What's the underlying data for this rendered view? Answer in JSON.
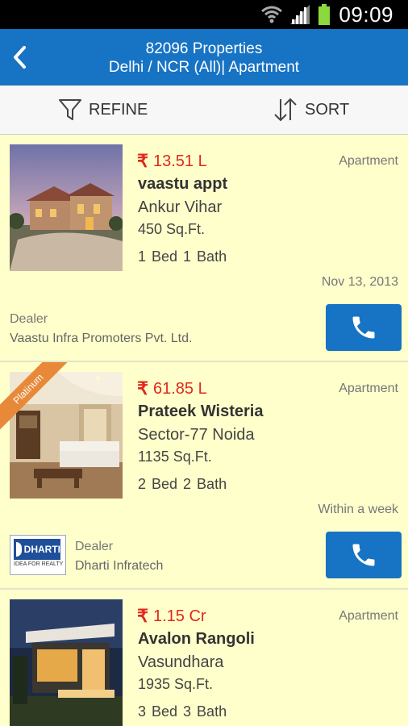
{
  "status_bar": {
    "time": "09:09"
  },
  "header": {
    "title_line1": "82096 Properties",
    "title_line2": "Delhi / NCR (All)| Apartment"
  },
  "toolbar": {
    "refine_label": "REFINE",
    "sort_label": "SORT"
  },
  "listings": [
    {
      "price": "13.51 L",
      "type": "Apartment",
      "name": "vaastu appt",
      "location": "Ankur Vihar",
      "area": "450 Sq.Ft.",
      "rooms": "1 Bed  1 Bath",
      "date": "Nov 13, 2013",
      "dealer_role": "Dealer",
      "dealer_name": "Vaastu Infra Promoters Pvt. Ltd."
    },
    {
      "badge": "Platinum",
      "price": "61.85 L",
      "type": "Apartment",
      "name": "Prateek Wisteria",
      "location": "Sector-77 Noida",
      "area": "1135 Sq.Ft.",
      "rooms": "2 Bed  2 Bath",
      "date": "Within a week",
      "dealer_role": "Dealer",
      "dealer_name": "Dharti Infratech",
      "dealer_logo_text": "DHARTI",
      "dealer_logo_tagline": "IDEA FOR REALTY"
    },
    {
      "price": "1.15 Cr",
      "type": "Apartment",
      "name": "Avalon Rangoli",
      "location": "Vasundhara",
      "area": "1935 Sq.Ft.",
      "rooms": "3 Bed  3 Bath"
    }
  ],
  "currency_symbol": "₹",
  "colors": {
    "accent": "#1773c4",
    "price": "#e0281c",
    "card_bg": "#ffffcc",
    "badge": "#e8893a"
  }
}
